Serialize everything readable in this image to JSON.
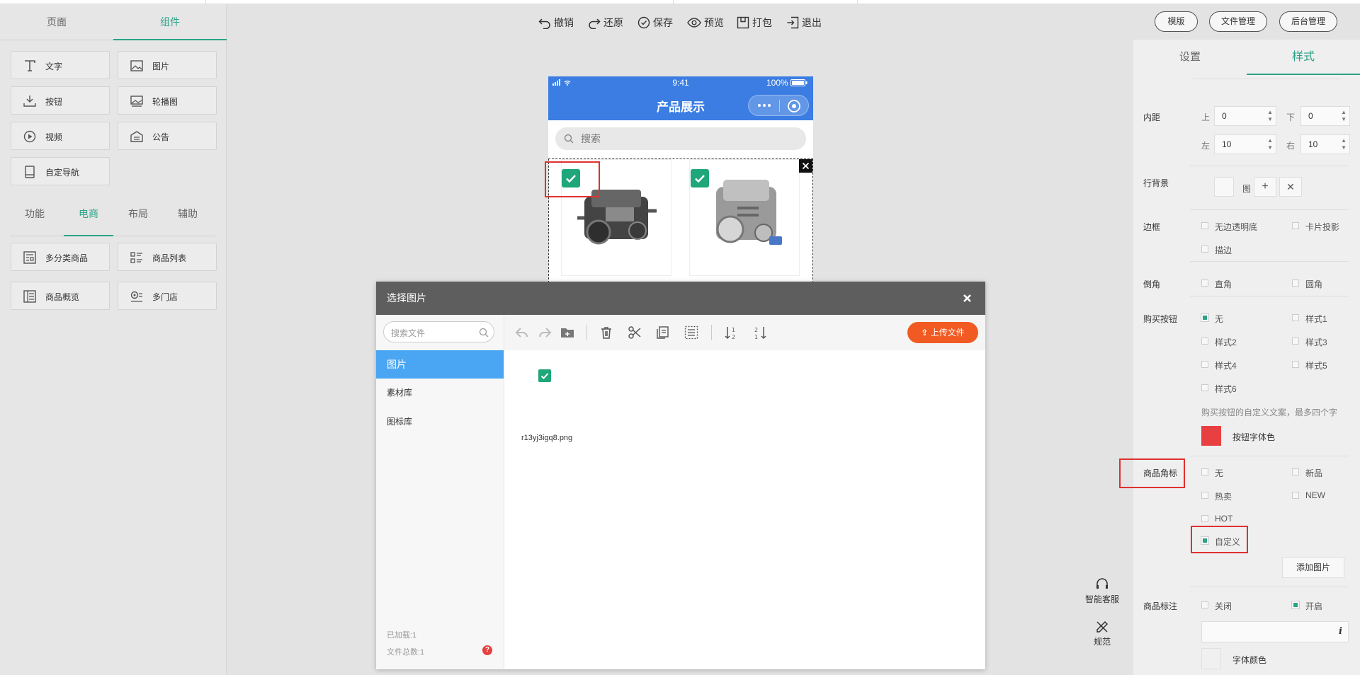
{
  "left_panel": {
    "tabs": [
      "页面",
      "组件"
    ],
    "components": [
      "文字",
      "图片",
      "按钮",
      "轮播图",
      "视频",
      "公告",
      "自定导航"
    ],
    "subtabs": [
      "功能",
      "电商",
      "布局",
      "辅助"
    ],
    "ecommerce": [
      "多分类商品",
      "商品列表",
      "商品概览",
      "多门店"
    ]
  },
  "toolbar": {
    "undo": "撤销",
    "redo": "还原",
    "save": "保存",
    "preview": "预览",
    "pack": "打包",
    "exit": "退出",
    "template": "模版",
    "file_manage": "文件管理",
    "backend": "后台管理"
  },
  "phone": {
    "time": "9:41",
    "battery": "100%",
    "title": "产品展示",
    "search_placeholder": "搜索"
  },
  "dialog": {
    "title": "选择图片",
    "search_placeholder": "搜索文件",
    "nav": [
      "图片",
      "素材库",
      "图标库"
    ],
    "upload": "上传文件",
    "file_name": "r13yj3igq8.png",
    "loaded": "已加载:1",
    "total": "文件总数:1"
  },
  "right_panel": {
    "tabs": [
      "设置",
      "样式"
    ],
    "padding": {
      "label": "内距",
      "top_label": "上",
      "top": "0",
      "bottom_label": "下",
      "bottom": "0",
      "left_label": "左",
      "left": "10",
      "right_label": "右",
      "right": "10"
    },
    "row_bg": {
      "label": "行背景",
      "img": "图"
    },
    "border": {
      "label": "边框",
      "options": [
        "无边透明底",
        "卡片投影",
        "描边"
      ]
    },
    "corner": {
      "label": "倒角",
      "options": [
        "直角",
        "圆角"
      ]
    },
    "buy_button": {
      "label": "购买按钮",
      "options": [
        "无",
        "样式1",
        "样式2",
        "样式3",
        "样式4",
        "样式5",
        "样式6"
      ],
      "hint": "购买按钮的自定义文案，最多四个字",
      "font_color": "按钮字体色"
    },
    "badge": {
      "label": "商品角标",
      "options": [
        "无",
        "新品",
        "热卖",
        "NEW",
        "HOT",
        "自定义"
      ],
      "add_image": "添加图片"
    },
    "mark": {
      "label": "商品标注",
      "options": [
        "关闭",
        "开启"
      ],
      "font_color": "字体颜色"
    }
  },
  "floating": {
    "service": "智能客服",
    "spec": "规范"
  },
  "colors": {
    "accent": "#2aa386",
    "header_blue": "#3b7de2",
    "upload_orange": "#f15a22",
    "swatch_red": "#e84040"
  }
}
